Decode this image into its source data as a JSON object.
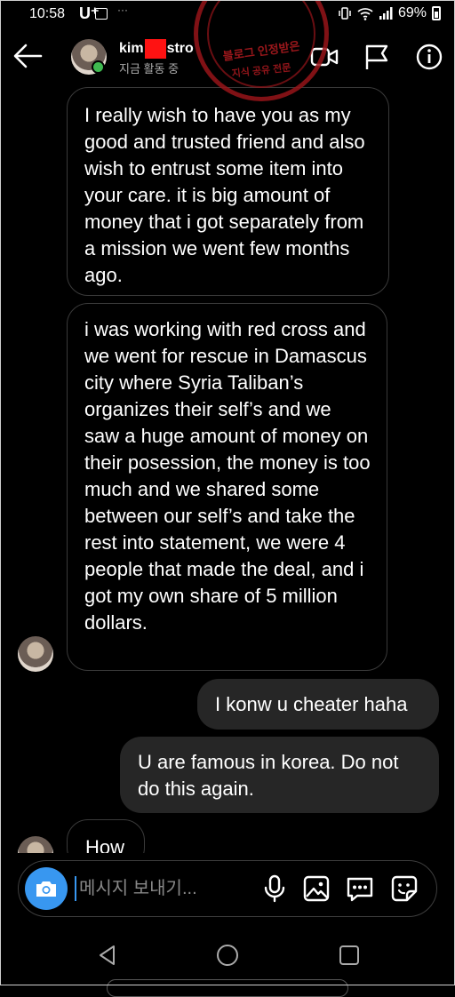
{
  "status_bar": {
    "time": "10:58",
    "carrier": "U⁺",
    "battery": "69%",
    "icons": [
      "gallery-icon",
      "more-dots-icon",
      "vibrate-icon",
      "wifi-icon",
      "signal-icon",
      "battery-icon"
    ]
  },
  "watermark": {
    "text_line1": "블로그 인정받은",
    "text_line2": "지식 공유 전문"
  },
  "header": {
    "contact_name_prefix": "kim",
    "contact_name_suffix": "stro",
    "status": "지금 활동 중",
    "icons": [
      "back-arrow-icon",
      "video-call-icon",
      "flag-icon",
      "info-icon"
    ],
    "online_color": "#3fb950"
  },
  "messages": [
    {
      "direction": "received",
      "text": "I really wish to have you as my good and trusted friend and also wish to entrust some item into your care. it is big amount of money that i got separately from a mission we went few months ago."
    },
    {
      "direction": "received",
      "text": "i was working with red cross and we went for rescue in Damascus city where Syria Taliban’s organizes their self’s and we saw a huge amount of money on their posession, the money is too much and we shared some between our self’s and take the rest into statement, we were 4 people that made the deal, and i got my own share of 5 million dollars."
    },
    {
      "direction": "sent",
      "text": "I konw u cheater haha"
    },
    {
      "direction": "sent",
      "text": "U are famous in korea. Do not do this again."
    },
    {
      "direction": "received",
      "text": "How"
    }
  ],
  "composer": {
    "placeholder": "메시지 보내기...",
    "icons": [
      "camera-icon",
      "microphone-icon",
      "gallery-image-icon",
      "chat-dots-icon",
      "sticker-icon"
    ],
    "accent": "#3897f0"
  },
  "navbar": {
    "icons": [
      "nav-back-icon",
      "nav-home-icon",
      "nav-recents-icon"
    ]
  },
  "colors": {
    "background": "#000000",
    "sent_bubble": "#262626",
    "received_border": "#3a3a3a"
  }
}
